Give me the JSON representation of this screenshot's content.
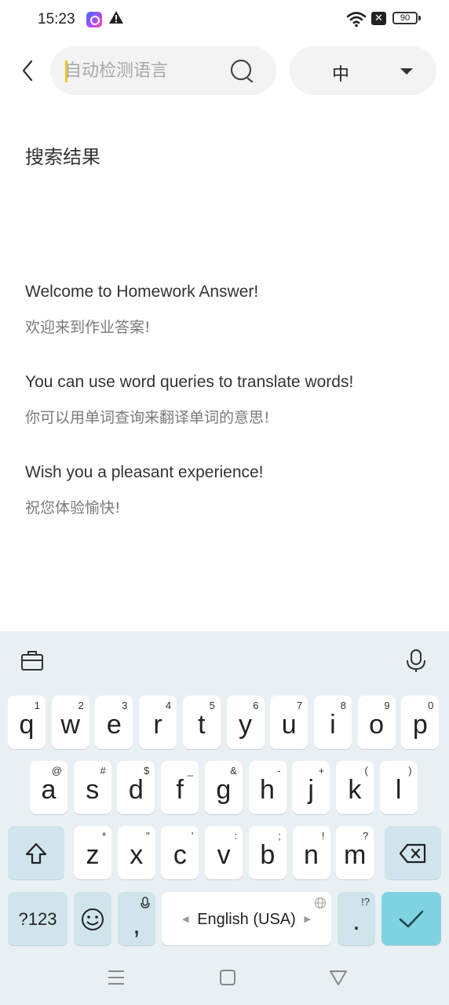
{
  "status": {
    "time": "15:23",
    "battery": "90",
    "icons": [
      "app-notification-icon",
      "warning-icon",
      "wifi-icon",
      "no-sim-icon",
      "battery-icon"
    ]
  },
  "search": {
    "placeholder": "自动检测语言",
    "value": ""
  },
  "language": {
    "selected": "中"
  },
  "results": {
    "title": "搜索结果",
    "items": [
      {
        "en": "Welcome to Homework Answer!",
        "zh": "欢迎来到作业答案!"
      },
      {
        "en": "You can use word queries to translate words!",
        "zh": "你可以用单词查询来翻译单词的意思!"
      },
      {
        "en": "Wish you a pleasant experience!",
        "zh": "祝您体验愉快!"
      }
    ]
  },
  "keyboard": {
    "row1": [
      {
        "k": "q",
        "h": "1"
      },
      {
        "k": "w",
        "h": "2"
      },
      {
        "k": "e",
        "h": "3"
      },
      {
        "k": "r",
        "h": "4"
      },
      {
        "k": "t",
        "h": "5"
      },
      {
        "k": "y",
        "h": "6"
      },
      {
        "k": "u",
        "h": "7"
      },
      {
        "k": "i",
        "h": "8"
      },
      {
        "k": "o",
        "h": "9"
      },
      {
        "k": "p",
        "h": "0"
      }
    ],
    "row2": [
      {
        "k": "a",
        "h": "@"
      },
      {
        "k": "s",
        "h": "#"
      },
      {
        "k": "d",
        "h": "$"
      },
      {
        "k": "f",
        "h": "_"
      },
      {
        "k": "g",
        "h": "&"
      },
      {
        "k": "h",
        "h": "-"
      },
      {
        "k": "j",
        "h": "+"
      },
      {
        "k": "k",
        "h": "("
      },
      {
        "k": "l",
        "h": ")"
      }
    ],
    "row3": [
      {
        "k": "z",
        "h": "*"
      },
      {
        "k": "x",
        "h": "\""
      },
      {
        "k": "c",
        "h": "'"
      },
      {
        "k": "v",
        "h": ":"
      },
      {
        "k": "b",
        "h": ";"
      },
      {
        "k": "n",
        "h": "!"
      },
      {
        "k": "m",
        "h": "?"
      }
    ],
    "symbols_label": "?123",
    "comma": ",",
    "space_label": "English (USA)",
    "period": ".",
    "period_hint": "!?"
  },
  "colors": {
    "caret": "#f5c518",
    "keyboard_bg": "#e9f0f3",
    "enter_key": "#7fd3e0",
    "function_key": "#cfe5eb"
  }
}
